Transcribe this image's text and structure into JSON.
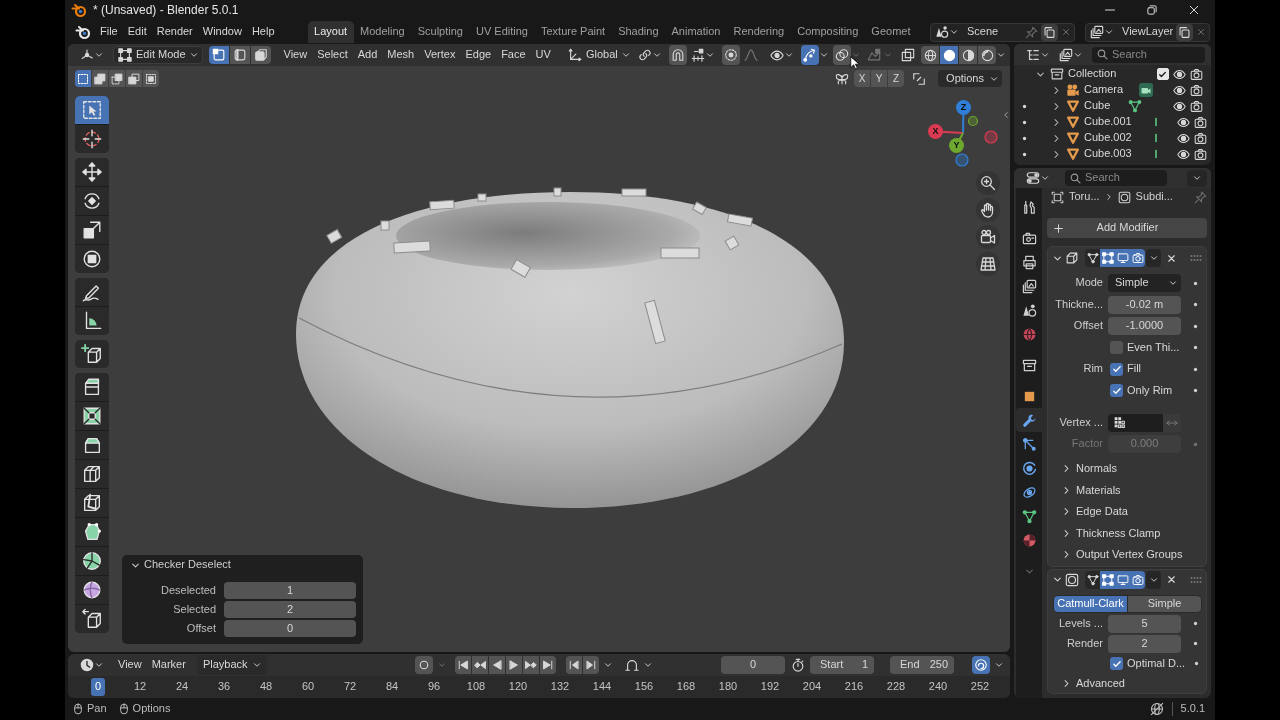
{
  "window": {
    "title": "* (Unsaved) - Blender 5.0.1"
  },
  "menu_bar": {
    "menus": [
      "File",
      "Edit",
      "Render",
      "Window",
      "Help"
    ],
    "workspaces": [
      {
        "label": "Layout",
        "selected": true
      },
      {
        "label": "Modeling",
        "selected": false
      },
      {
        "label": "Sculpting",
        "selected": false
      },
      {
        "label": "UV Editing",
        "selected": false
      },
      {
        "label": "Texture Paint",
        "selected": false
      },
      {
        "label": "Shading",
        "selected": false
      },
      {
        "label": "Animation",
        "selected": false
      },
      {
        "label": "Rendering",
        "selected": false
      },
      {
        "label": "Compositing",
        "selected": false
      },
      {
        "label": "Geomet",
        "selected": false
      }
    ],
    "scene": "Scene",
    "view_layer": "ViewLayer"
  },
  "viewport": {
    "header": {
      "mode": "Edit Mode",
      "select_modes": [
        {
          "kind": "vertex",
          "selected": true
        },
        {
          "kind": "edge",
          "selected": false
        },
        {
          "kind": "face",
          "selected": false
        }
      ],
      "menus": [
        "View",
        "Select",
        "Add",
        "Mesh",
        "Vertex",
        "Edge",
        "Face",
        "UV"
      ],
      "orientation": "Global",
      "toggles": [
        {
          "kind": "snap",
          "on": false
        },
        {
          "kind": "proportional",
          "on": false
        },
        {
          "kind": "gizmos",
          "on": true
        },
        {
          "kind": "overlays",
          "on": false
        }
      ],
      "shading": [
        {
          "kind": "wireframe",
          "selected": false
        },
        {
          "kind": "solid",
          "selected": true
        },
        {
          "kind": "material",
          "selected": false
        },
        {
          "kind": "rendered",
          "selected": false
        }
      ]
    },
    "tool_settings": {
      "select_box_modes": [
        {
          "kind": "set",
          "selected": true
        },
        {
          "kind": "extend",
          "selected": false
        },
        {
          "kind": "subtract",
          "selected": false
        },
        {
          "kind": "invert",
          "selected": false
        },
        {
          "kind": "intersect",
          "selected": false
        }
      ],
      "mirror_axes": [
        {
          "label": "X",
          "on": false
        },
        {
          "label": "Y",
          "on": false
        },
        {
          "label": "Z",
          "on": false
        }
      ],
      "options": "Options"
    },
    "toolbar": [
      [
        {
          "kind": "select_box",
          "selected": true
        },
        {
          "kind": "cursor",
          "selected": false
        }
      ],
      [
        {
          "kind": "move",
          "selected": false
        },
        {
          "kind": "rotate",
          "selected": false
        },
        {
          "kind": "scale",
          "selected": false
        },
        {
          "kind": "transform",
          "selected": false
        }
      ],
      [
        {
          "kind": "annotate",
          "selected": false
        },
        {
          "kind": "measure",
          "selected": false
        }
      ],
      [
        {
          "kind": "add_cube",
          "selected": false
        }
      ],
      [
        {
          "kind": "extrude",
          "selected": false
        },
        {
          "kind": "inset",
          "selected": false
        },
        {
          "kind": "bevel",
          "selected": false
        },
        {
          "kind": "loop_cut",
          "selected": false
        },
        {
          "kind": "knife",
          "selected": false
        },
        {
          "kind": "poly_build",
          "selected": false
        },
        {
          "kind": "spin",
          "selected": false
        },
        {
          "kind": "smooth",
          "selected": false
        },
        {
          "kind": "shear",
          "selected": false
        }
      ]
    ],
    "gizmo_axes": [
      {
        "label": "Z",
        "color": "#2f7fd8"
      },
      {
        "label": "X",
        "color": "#dc3a52"
      },
      {
        "label": "Y",
        "color": "#6ea82c"
      }
    ],
    "last_operation": {
      "title": "Checker Deselect",
      "expanded": true,
      "fields": [
        {
          "label": "Deselected",
          "value": "1"
        },
        {
          "label": "Selected",
          "value": "2"
        },
        {
          "label": "Offset",
          "value": "0"
        }
      ]
    }
  },
  "timeline": {
    "menus": [
      "View",
      "Marker"
    ],
    "playback": "Playback",
    "auto_keying": false,
    "current_frame": "0",
    "start": {
      "label": "Start",
      "value": "1"
    },
    "end": {
      "label": "End",
      "value": "250"
    },
    "view_toggle_on": true,
    "ruler": [
      {
        "label": "0",
        "selected": true
      },
      {
        "label": "12",
        "selected": false
      },
      {
        "label": "24",
        "selected": false
      },
      {
        "label": "36",
        "selected": false
      },
      {
        "label": "48",
        "selected": false
      },
      {
        "label": "60",
        "selected": false
      },
      {
        "label": "72",
        "selected": false
      },
      {
        "label": "84",
        "selected": false
      },
      {
        "label": "96",
        "selected": false
      },
      {
        "label": "108",
        "selected": false
      },
      {
        "label": "120",
        "selected": false
      },
      {
        "label": "132",
        "selected": false
      },
      {
        "label": "144",
        "selected": false
      },
      {
        "label": "156",
        "selected": false
      },
      {
        "label": "168",
        "selected": false
      },
      {
        "label": "180",
        "selected": false
      },
      {
        "label": "192",
        "selected": false
      },
      {
        "label": "204",
        "selected": false
      },
      {
        "label": "216",
        "selected": false
      },
      {
        "label": "228",
        "selected": false
      },
      {
        "label": "240",
        "selected": false
      },
      {
        "label": "252",
        "selected": false
      }
    ]
  },
  "status_bar": {
    "hints": [
      "Pan",
      "Options"
    ],
    "version": "5.0.1"
  },
  "outliner": {
    "search_placeholder": "Search",
    "tree": [
      {
        "label": "Collection",
        "kind": "collection",
        "expanded": true,
        "checked": true,
        "children": [
          {
            "label": "Camera",
            "kind": "camera",
            "expanded": false,
            "badge": {
              "kind": "camera"
            }
          },
          {
            "label": "Cube",
            "kind": "mesh",
            "expanded": false,
            "badge": {
              "kind": "mesh"
            }
          },
          {
            "label": "Cube.001",
            "kind": "mesh",
            "expanded": false,
            "badge": {
              "kind": "mark"
            }
          },
          {
            "label": "Cube.002",
            "kind": "mesh",
            "expanded": false,
            "badge": {
              "kind": "mark"
            }
          },
          {
            "label": "Cube.003",
            "kind": "mesh",
            "expanded": false,
            "badge": {
              "kind": "mark"
            }
          }
        ]
      }
    ]
  },
  "properties": {
    "search_placeholder": "Search",
    "tabs": [
      [
        {
          "kind": "tool",
          "selected": false
        }
      ],
      [
        {
          "kind": "render",
          "selected": false
        },
        {
          "kind": "output",
          "selected": false
        },
        {
          "kind": "view_layer",
          "selected": false
        },
        {
          "kind": "scene",
          "selected": false
        },
        {
          "kind": "world",
          "selected": false
        }
      ],
      [
        {
          "kind": "collection",
          "selected": false
        }
      ],
      [
        {
          "kind": "object",
          "selected": false
        },
        {
          "kind": "modifiers",
          "selected": true
        },
        {
          "kind": "particles",
          "selected": false
        },
        {
          "kind": "physics",
          "selected": false
        },
        {
          "kind": "constraints",
          "selected": false
        },
        {
          "kind": "data",
          "selected": false
        },
        {
          "kind": "material",
          "selected": false
        }
      ]
    ],
    "breadcrumb": [
      "Toru...",
      "Subdi..."
    ],
    "add_modifier": "Add Modifier",
    "modifiers": [
      {
        "kind": "solidify",
        "expanded": true,
        "toggles": [
          {
            "kind": "on_cage",
            "on": false
          },
          {
            "kind": "edit_mode",
            "on": true
          },
          {
            "kind": "viewport",
            "on": true
          },
          {
            "kind": "render",
            "on": true
          }
        ],
        "rows": [
          {
            "kind": "dropdown",
            "label": "Mode",
            "value": "Simple",
            "disabled": false
          },
          {
            "kind": "number",
            "label": "Thickne...",
            "value": "-0.02 m",
            "disabled": false
          },
          {
            "kind": "number",
            "label": "Offset",
            "value": "-1.0000",
            "disabled": false
          },
          {
            "kind": "checkbox",
            "label": "Even Thi...",
            "checked": false,
            "disabled": false
          },
          {
            "kind": "checkbox",
            "row_label": "Rim",
            "label": "Fill",
            "checked": true,
            "disabled": false
          },
          {
            "kind": "checkbox",
            "label": "Only Rim",
            "checked": true,
            "disabled": false
          },
          {
            "kind": "vertex_group",
            "label": "Vertex ...",
            "disabled": false
          },
          {
            "kind": "number",
            "label": "Factor",
            "value": "0.000",
            "disabled": true
          }
        ],
        "subpanels": [
          {
            "label": "Normals",
            "expanded": false
          },
          {
            "label": "Materials",
            "expanded": false
          },
          {
            "label": "Edge Data",
            "expanded": false
          },
          {
            "label": "Thickness Clamp",
            "expanded": false
          },
          {
            "label": "Output Vertex Groups",
            "expanded": false
          }
        ]
      },
      {
        "kind": "subdivision",
        "expanded": true,
        "toggles": [
          {
            "kind": "on_cage",
            "on": false
          },
          {
            "kind": "edit_mode",
            "on": true
          },
          {
            "kind": "viewport",
            "on": true
          },
          {
            "kind": "render",
            "on": true
          }
        ],
        "rows": [
          {
            "kind": "segmented",
            "options": [
              {
                "label": "Catmull-Clark",
                "selected": true
              },
              {
                "label": "Simple",
                "selected": false
              }
            ],
            "disabled": false
          },
          {
            "kind": "number",
            "label": "Levels ...",
            "value": "5",
            "disabled": false
          },
          {
            "kind": "number",
            "label": "Render",
            "value": "2",
            "disabled": false
          },
          {
            "kind": "checkbox",
            "label": "Optimal D...",
            "checked": true,
            "disabled": false
          }
        ],
        "subpanels": [
          {
            "label": "Advanced",
            "expanded": false
          }
        ]
      }
    ]
  }
}
